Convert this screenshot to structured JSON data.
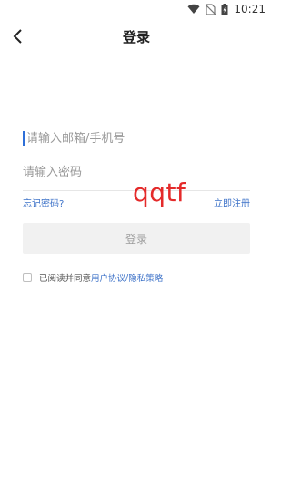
{
  "status_bar": {
    "time": "10:21",
    "icons": [
      "wifi-icon",
      "no-sim-icon",
      "battery-icon"
    ]
  },
  "nav": {
    "title": "登录",
    "back_icon": "chevron-left-icon"
  },
  "form": {
    "account_placeholder": "请输入邮箱/手机号",
    "password_placeholder": "请输入密码",
    "forgot_password": "忘记密码?",
    "register": "立即注册",
    "login_button": "登录"
  },
  "agreement": {
    "prefix": "已阅读并同意",
    "user_agreement": "用户协议",
    "separator": "/",
    "privacy_policy": "隐私策略",
    "checked": false
  },
  "watermark": {
    "text": "qqtf"
  },
  "colors": {
    "accent_line": "#e84848",
    "link": "#3d72c8",
    "button_bg": "#f1f1f1",
    "watermark": "#e42a2a"
  }
}
